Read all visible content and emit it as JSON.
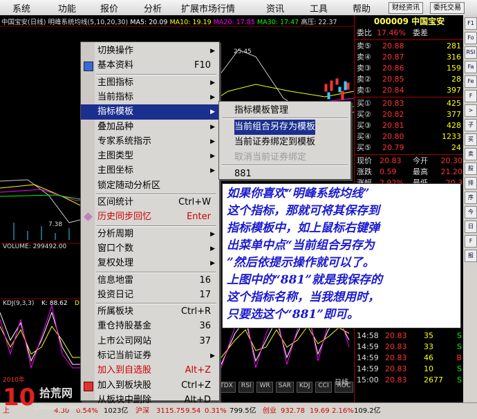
{
  "menubar": {
    "items": [
      "系统",
      "功能",
      "报价",
      "分析",
      "扩展市场行情",
      "资讯",
      "工具",
      "帮助"
    ],
    "btn_news": "财经资讯",
    "btn_trade": "委托交易"
  },
  "chart": {
    "title_name": "中国宝安(日线)",
    "title_indicator": "明峰系统均线(5,10,20,30)",
    "ma5": "MA5: 20.09",
    "ma10": "MA10: 19.19",
    "ma20": "MA20: 17.85",
    "ma30": "MA30: 17.47",
    "high": "高压: 22.37",
    "price_top": "25.45",
    "price_low": "7.38",
    "volume": "VOLUME: 299492.00",
    "kdj": "KDJ(9,3,3)",
    "k_val": "K: 88.62",
    "d_val": "D: 81.",
    "year": "2010年",
    "tabs": [
      "DL-TDX",
      "RSI",
      "WR",
      "SAR",
      "KDJ",
      "CCI",
      "ROC"
    ],
    "period": "日线"
  },
  "quote": {
    "code": "000009",
    "name": "中国宝安",
    "ratio_label": "委比",
    "ratio_val": "17.46%",
    "diff_label": "委差",
    "sells": [
      {
        "label": "卖⑤",
        "price": "20.88",
        "vol": "281"
      },
      {
        "label": "卖④",
        "price": "20.87",
        "vol": "316"
      },
      {
        "label": "卖③",
        "price": "20.86",
        "vol": "159"
      },
      {
        "label": "卖②",
        "price": "20.85",
        "vol": "28"
      },
      {
        "label": "卖①",
        "price": "20.84",
        "vol": "397"
      }
    ],
    "buys": [
      {
        "label": "买①",
        "price": "20.83",
        "vol": "425"
      },
      {
        "label": "买②",
        "price": "20.82",
        "vol": "377"
      },
      {
        "label": "买③",
        "price": "20.81",
        "vol": "428"
      },
      {
        "label": "买④",
        "price": "20.80",
        "vol": "1233"
      },
      {
        "label": "买⑤",
        "price": "20.79",
        "vol": "24"
      }
    ],
    "stats": [
      {
        "l1": "现价",
        "v1": "20.83",
        "l2": "今开",
        "v2": "20.30"
      },
      {
        "l1": "涨跌",
        "v1": "0.59",
        "l2": "最高",
        "v2": "21.20"
      },
      {
        "l1": "涨幅",
        "v1": "2.92%",
        "l2": "最低",
        "v2": "20.3"
      }
    ],
    "ticks": [
      {
        "time": "14:58",
        "price": "20.83",
        "vol": "23",
        "dir": "S"
      },
      {
        "time": "14:58",
        "price": "20.83",
        "vol": "35",
        "dir": "S"
      },
      {
        "time": "14:59",
        "price": "20.83",
        "vol": "33",
        "dir": "S"
      },
      {
        "time": "14:59",
        "price": "20.83",
        "vol": "46",
        "dir": "B"
      },
      {
        "time": "14:59",
        "price": "20.83",
        "vol": "10",
        "dir": "S"
      },
      {
        "time": "15:00",
        "price": "20.83",
        "vol": "2677",
        "dir": "S"
      }
    ]
  },
  "toolstrip": [
    "F1",
    "Fo",
    "RSI",
    "Fa",
    "Fe",
    "F",
    ">",
    "子",
    "买",
    "卖",
    "股",
    "排",
    "序",
    "今",
    "日",
    "F",
    "报"
  ],
  "status": {
    "a": "上",
    "b": "4.30",
    "c": "0.54%",
    "d": "1023亿",
    "e": "沪深",
    "f": "3115.75",
    "g": "9.54",
    "h": "0.31%",
    "i": "799.5亿",
    "j": "创业",
    "k": "932.78",
    "l": "19.69",
    "m": "2.16%",
    "n": "109.2亿"
  },
  "logo": {
    "num": "10",
    "text": "拾荒网",
    "sub": "10huang.com"
  },
  "context_menu": {
    "items": [
      {
        "label": "切换操作",
        "key": "",
        "arrow": true
      },
      {
        "label": "基本资料",
        "key": "F10",
        "arrow": false,
        "icon": "f10-icon"
      },
      {
        "label": "主图指标",
        "key": "",
        "arrow": true
      },
      {
        "label": "当前指标",
        "key": "",
        "arrow": true
      },
      {
        "label": "指标模板",
        "key": "",
        "arrow": true,
        "hl": true
      },
      {
        "label": "叠加品种",
        "key": "",
        "arrow": true
      },
      {
        "label": "专家系统指示",
        "key": "",
        "arrow": true
      },
      {
        "label": "主图类型",
        "key": "",
        "arrow": true
      },
      {
        "label": "主图坐标",
        "key": "",
        "arrow": true
      },
      {
        "label": "锁定随动分析区",
        "key": "",
        "arrow": false
      },
      {
        "label": "区间统计",
        "key": "Ctrl+W",
        "arrow": false
      },
      {
        "label": "历史同步回忆",
        "key": "Enter",
        "arrow": false,
        "red": true,
        "icon": "memory-icon"
      },
      {
        "label": "分析周期",
        "key": "",
        "arrow": true
      },
      {
        "label": "窗口个数",
        "key": "",
        "arrow": true
      },
      {
        "label": "复权处理",
        "key": "",
        "arrow": true
      },
      {
        "label": "信息地雷",
        "key": "16",
        "arrow": false
      },
      {
        "label": "投资日记",
        "key": "17",
        "arrow": false
      },
      {
        "label": "所属板块",
        "key": "Ctrl+R",
        "arrow": false
      },
      {
        "label": "重仓持股基金",
        "key": "36",
        "arrow": false
      },
      {
        "label": "上市公司网站",
        "key": "37",
        "arrow": false
      },
      {
        "label": "标记当前证券",
        "key": "",
        "arrow": true
      },
      {
        "label": "加入到自选股",
        "key": "Alt+Z",
        "arrow": false,
        "red": true
      },
      {
        "label": "加入到板块股",
        "key": "Ctrl+Z",
        "arrow": false,
        "icon": "add-block-icon"
      },
      {
        "label": "从板块中删除",
        "key": "Alt+D",
        "arrow": false
      }
    ]
  },
  "submenu": {
    "items": [
      {
        "label": "指标模板管理"
      },
      {
        "label": "当前组合另存为模板",
        "hl": true
      },
      {
        "label": "当前证券绑定到模板"
      },
      {
        "label": "取消当前证券绑定",
        "disabled": true
      },
      {
        "label": "881"
      }
    ]
  },
  "note": {
    "lines": [
      "如果你喜欢“明峰系统均线”",
      "这个指标，那就可将其保存到",
      "指标模板中，如上鼠标右键弹",
      "出菜单中点“当前组合另存为",
      "”然后依提示操作就可以了。",
      "上图中的“881”就是我保存的",
      "这个指标名称，当我想用时，",
      "只要选这个“881”即可。"
    ]
  }
}
